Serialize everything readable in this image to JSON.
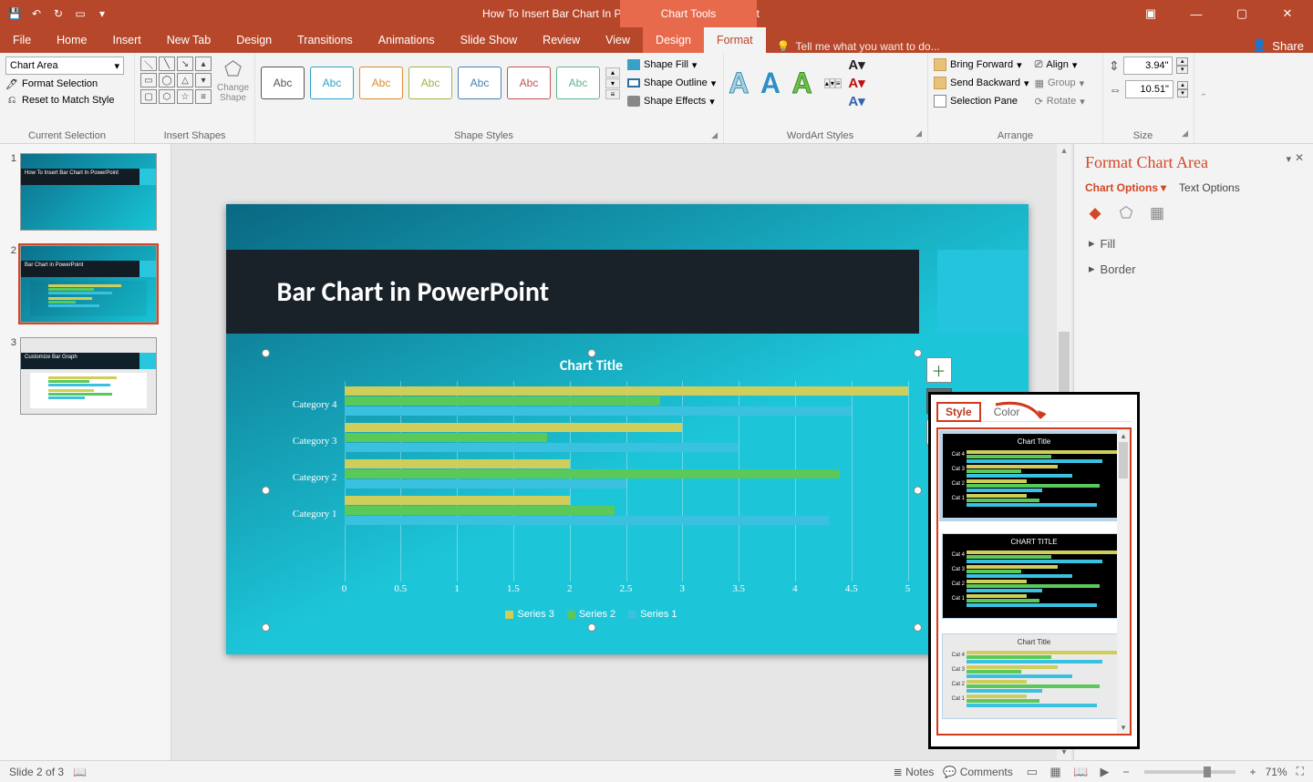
{
  "titlebar": {
    "doc_title": "How To Insert Bar Chart In PowerPoint.pptx - PowerPoint",
    "context_title": "Chart Tools"
  },
  "tabs": {
    "file": "File",
    "home": "Home",
    "insert": "Insert",
    "newtab": "New Tab",
    "design": "Design",
    "transitions": "Transitions",
    "animations": "Animations",
    "slideshow": "Slide Show",
    "review": "Review",
    "view": "View",
    "cdesign": "Design",
    "cformat": "Format",
    "tellme": "Tell me what you want to do...",
    "share": "Share"
  },
  "ribbon": {
    "current_selection": {
      "label": "Current Selection",
      "element": "Chart Area",
      "format_selection": "Format Selection",
      "reset_match": "Reset to Match Style"
    },
    "insert_shapes": {
      "label": "Insert Shapes",
      "change_shape": "Change Shape"
    },
    "shape_styles": {
      "label": "Shape Styles",
      "abc": "Abc",
      "fill": "Shape Fill",
      "outline": "Shape Outline",
      "effects": "Shape Effects"
    },
    "wordart": {
      "label": "WordArt Styles",
      "A": "A"
    },
    "arrange": {
      "label": "Arrange",
      "bring_forward": "Bring Forward",
      "send_backward": "Send Backward",
      "selection_pane": "Selection Pane",
      "align": "Align",
      "group": "Group",
      "rotate": "Rotate"
    },
    "size": {
      "label": "Size",
      "height": "3.94\"",
      "width": "10.51\""
    }
  },
  "thumbnails": {
    "t1": {
      "num": "1",
      "title": "How To Insert Bar Chart In PowerPoint"
    },
    "t2": {
      "num": "2",
      "title": "Bar Chart in PowerPoint"
    },
    "t3": {
      "num": "3",
      "title": "Customize Bar Graph"
    }
  },
  "slide": {
    "title": "Bar Chart in PowerPoint"
  },
  "chart_data": {
    "type": "bar",
    "title": "Chart Title",
    "categories": [
      "Category 4",
      "Category 3",
      "Category 2",
      "Category 1"
    ],
    "series": [
      {
        "name": "Series 3",
        "values": [
          5.0,
          3.0,
          2.0,
          2.0
        ],
        "color": "#d0ce5a"
      },
      {
        "name": "Series 2",
        "values": [
          2.8,
          1.8,
          4.4,
          2.4
        ],
        "color": "#5ac95a"
      },
      {
        "name": "Series 1",
        "values": [
          4.5,
          3.5,
          2.5,
          4.3
        ],
        "color": "#3ac1e0"
      }
    ],
    "x_ticks": [
      "0",
      "0.5",
      "1",
      "1.5",
      "2",
      "2.5",
      "3",
      "3.5",
      "4",
      "4.5",
      "5"
    ],
    "xlim": [
      0,
      5
    ],
    "legend_position": "bottom"
  },
  "format_pane": {
    "title": "Format Chart Area",
    "tab_chart_options": "Chart Options",
    "tab_text_options": "Text Options",
    "fill": "Fill",
    "border": "Border"
  },
  "flyout": {
    "tab_style": "Style",
    "tab_color": "Color",
    "preview_title": "Chart Title",
    "preview_title_upper": "CHART TITLE"
  },
  "status": {
    "slide_of": "Slide 2 of 3",
    "notes": "Notes",
    "comments": "Comments",
    "zoom": "71%"
  }
}
